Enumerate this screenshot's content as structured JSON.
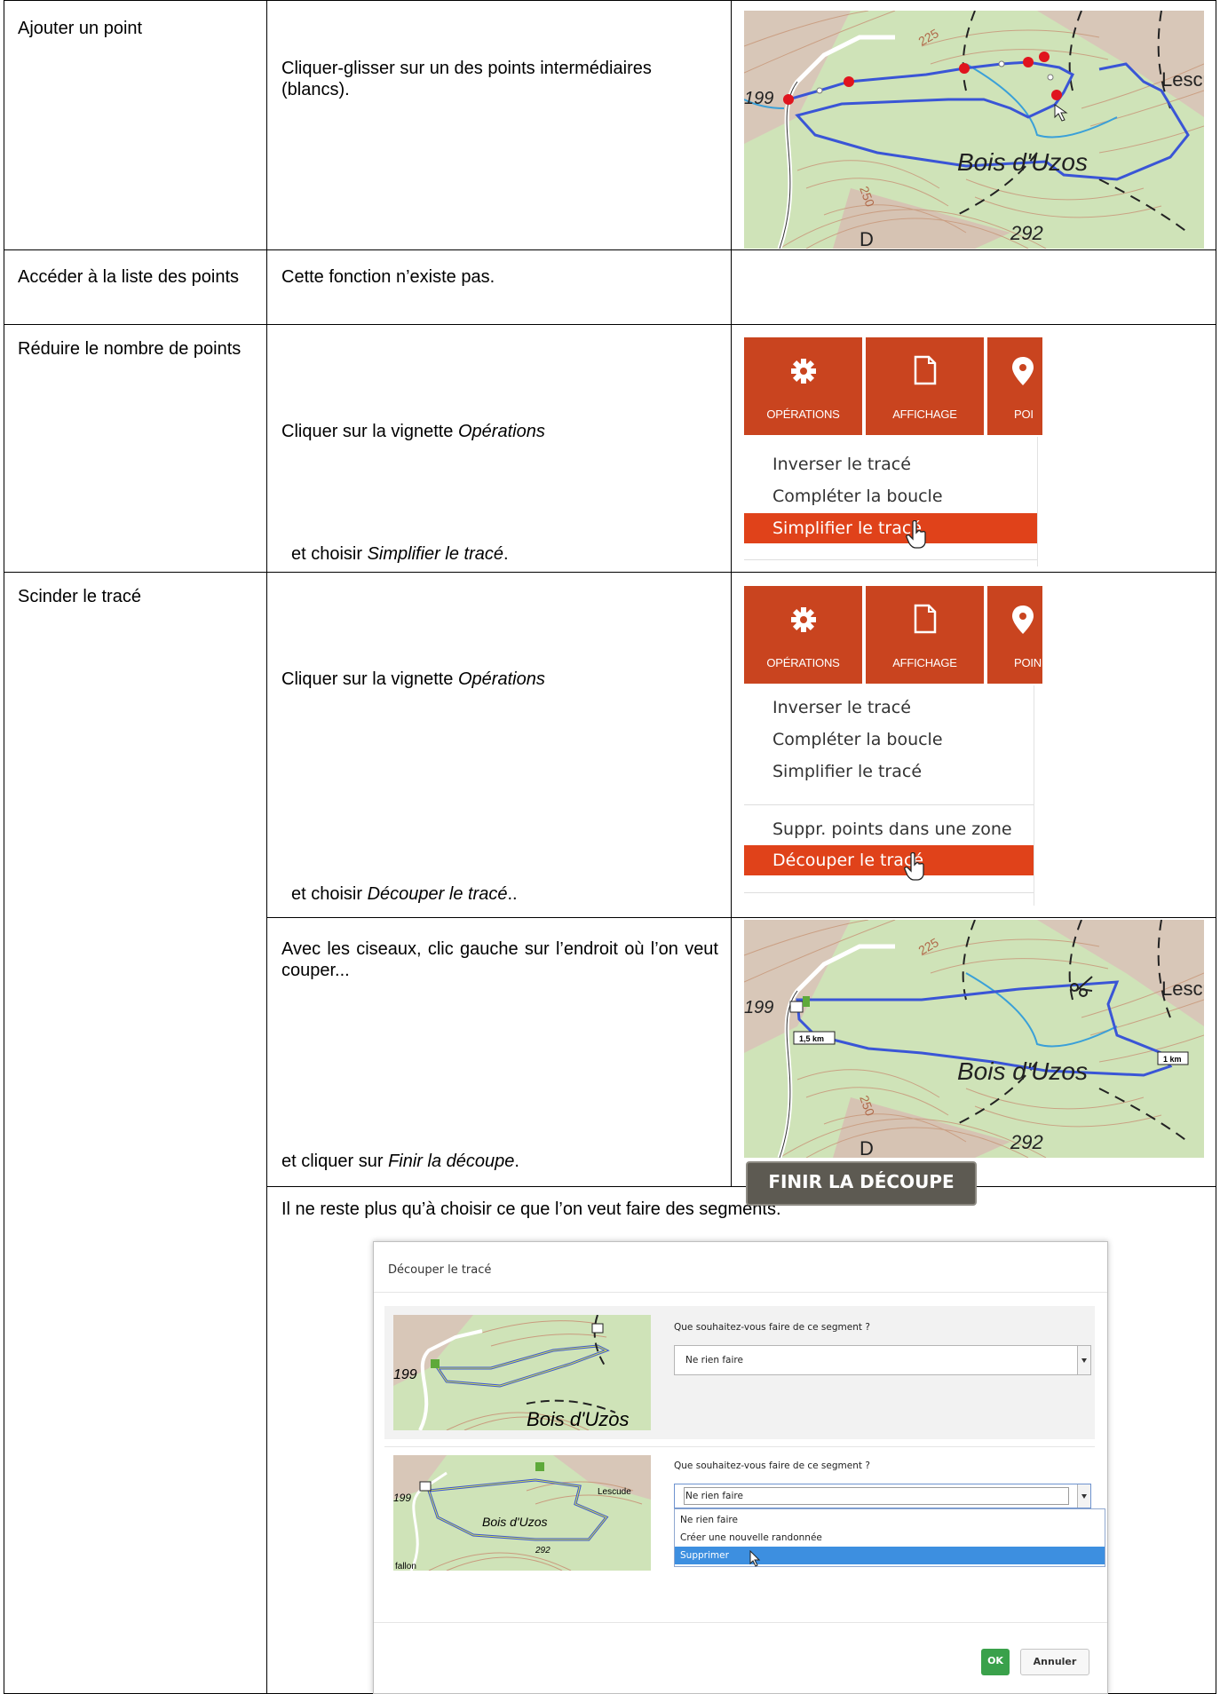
{
  "rows": [
    {
      "label": "Ajouter un point",
      "instruction": "Cliquer-glisser sur un des points intermédiaires (blancs)."
    },
    {
      "label": "Accéder à la liste des points",
      "instruction": "Cette fonction n’existe pas."
    },
    {
      "label": "Réduire le nombre de points",
      "instruction_a_prefix": "Cliquer sur la vignette ",
      "instruction_a_em": "Opérations",
      "instruction_b_prefix": "et choisir ",
      "instruction_b_em": "Simplifier le tracé",
      "instruction_b_suffix": "."
    },
    {
      "label": "Scinder le tracé",
      "instruction_a_prefix": "Cliquer sur la vignette ",
      "instruction_a_em": "Opérations",
      "instruction_b_prefix": "et choisir ",
      "instruction_b_em": "Découper le tracé",
      "instruction_b_suffix": ".."
    }
  ],
  "scissors_step": {
    "text": "Avec les ciseaux, clic gauche sur l’endroit où l’on veut couper...",
    "finish_prefix": "et cliquer sur ",
    "finish_em": "Finir la découpe",
    "finish_suffix": "."
  },
  "segments_step": {
    "text": "Il ne reste plus qu’à choisir ce que l’on veut faire des segments."
  },
  "map_labels": {
    "alt_199": "199",
    "alt_225": "225",
    "alt_250": "250",
    "alt_292": "292",
    "place_lescu": "Lescu",
    "place_bois": "Bois d'Uzos",
    "road_d": "D",
    "dist_1_5": "1,5 km",
    "dist_1": "1 km"
  },
  "toolbar": {
    "operations": "OPÉRATIONS",
    "affichage": "AFFICHAGE",
    "points_partial": "POI",
    "points_partial_2": "POIN"
  },
  "menu_simplify": [
    "Inverser le tracé",
    "Compléter la boucle",
    "Simplifier le tracé"
  ],
  "menu_cut": [
    "Inverser le tracé",
    "Compléter la boucle",
    "Simplifier le tracé",
    "Suppr. points dans une zone",
    "Découper le tracé"
  ],
  "finish_button": "FINIR LA DÉCOUPE",
  "dialog": {
    "title": "Découper le tracé",
    "question": "Que souhaitez-vous faire de ce segment ?",
    "segment1_value": "Ne rien faire",
    "segment2_value": "Ne rien faire",
    "options": [
      "Ne rien faire",
      "Créer une nouvelle randonnée",
      "Supprimer"
    ],
    "thumb1_labels": {
      "alt": "199",
      "place": "Bois d'Uzos"
    },
    "thumb2_labels": {
      "alt": "199",
      "place": "Bois d'Uzos",
      "lescude": "Lescude",
      "alt292": "292",
      "fallon": "fallon"
    },
    "ok": "OK",
    "cancel": "Annuler"
  },
  "colors": {
    "tile": "#c9441f",
    "menu_active": "#e0421a",
    "route": "#3a55d6",
    "ok_button": "#3aa14b",
    "dropdown_selected": "#3d8fe0"
  }
}
